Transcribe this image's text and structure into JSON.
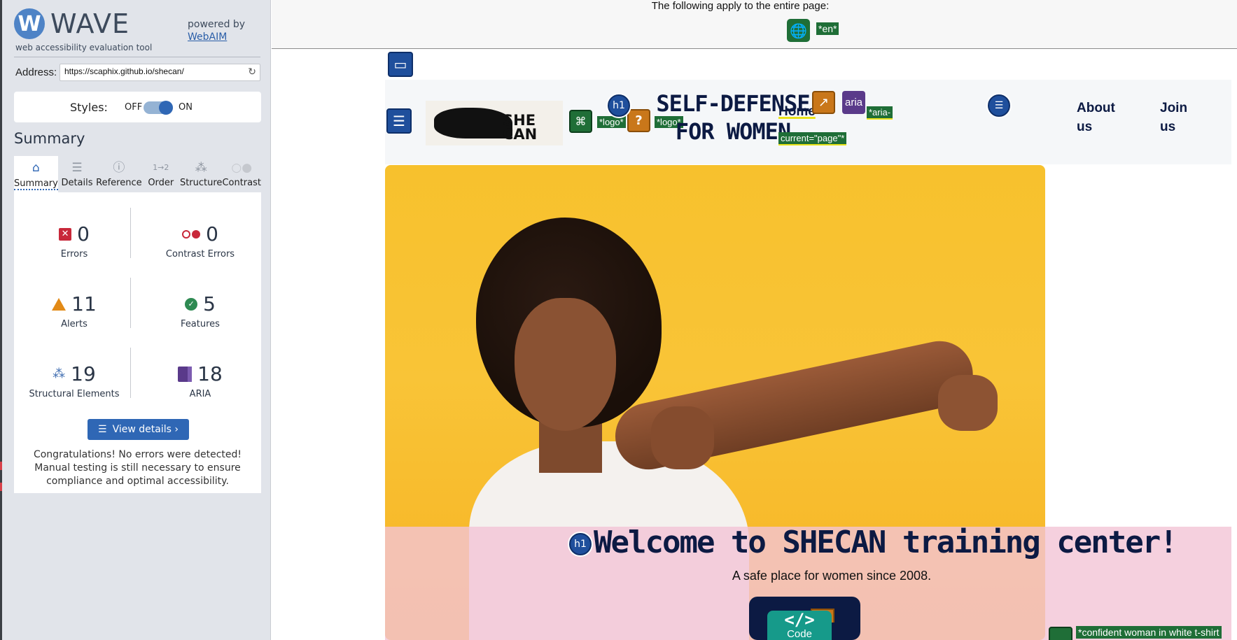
{
  "sidebar": {
    "logo_mark": "W",
    "logo_text": "WAVE",
    "logo_subtitle": "web accessibility evaluation tool",
    "powered_by": "powered by",
    "powered_by_link": "WebAIM",
    "address_label": "Address:",
    "address_value": "https://scaphix.github.io/shecan/",
    "styles_label": "Styles:",
    "styles_off": "OFF",
    "styles_on": "ON",
    "styles_state": "on",
    "summary_heading": "Summary",
    "tabs": [
      {
        "label": "Summary",
        "icon": "home-icon",
        "active": true
      },
      {
        "label": "Details",
        "icon": "list-icon",
        "active": false
      },
      {
        "label": "Reference",
        "icon": "info-icon",
        "active": false
      },
      {
        "label": "Order",
        "icon": "order-icon",
        "active": false
      },
      {
        "label": "Structure",
        "icon": "structure-icon",
        "active": false
      },
      {
        "label": "Contrast",
        "icon": "contrast-icon",
        "active": false
      }
    ],
    "stats": {
      "errors": {
        "value": "0",
        "label": "Errors",
        "color": "#c8283a"
      },
      "contrast_errors": {
        "value": "0",
        "label": "Contrast Errors",
        "color": "#c8283a"
      },
      "alerts": {
        "value": "11",
        "label": "Alerts",
        "color": "#e28a17"
      },
      "features": {
        "value": "5",
        "label": "Features",
        "color": "#2e8a52"
      },
      "structural": {
        "value": "19",
        "label": "Structural Elements",
        "color": "#3e6cb0"
      },
      "aria": {
        "value": "18",
        "label": "ARIA",
        "color": "#5a3a8a"
      }
    },
    "view_details": "View details ›",
    "congrats": "Congratulations! No errors were detected! Manual testing is still necessary to ensure compliance and optimal accessibility."
  },
  "page": {
    "banner_text": "The following apply to the entire page:",
    "lang_tag": "*en*",
    "header": {
      "logo_text": "SHE CAN",
      "logo_tag_1": "*logo*",
      "logo_tag_2": "*logo*",
      "h1_badge": "h1",
      "site_title": "SELF-DEFENSE FOR WOMEN",
      "nav": {
        "home": "Home",
        "aria_icon_label": "aria",
        "aria_tag_a": "*aria-",
        "aria_tag_b": "current=\"page\"*",
        "about": "About us",
        "join": "Join us"
      }
    },
    "hero": {
      "h1_badge": "h1",
      "title": "Welcome to SHECAN training center!",
      "subtitle": "A safe place for women since 2008.",
      "code_icon_symbol": "</>",
      "code_icon_label": "Code",
      "alt_tag": "*confident woman in white t-shirt"
    }
  },
  "colors": {
    "wave_blue": "#2f67b5",
    "wave_green": "#1f6e37",
    "heading_navy": "#0c1a43",
    "hero_yellow": "#f7c12d",
    "band_pink": "#f3c4d6"
  }
}
